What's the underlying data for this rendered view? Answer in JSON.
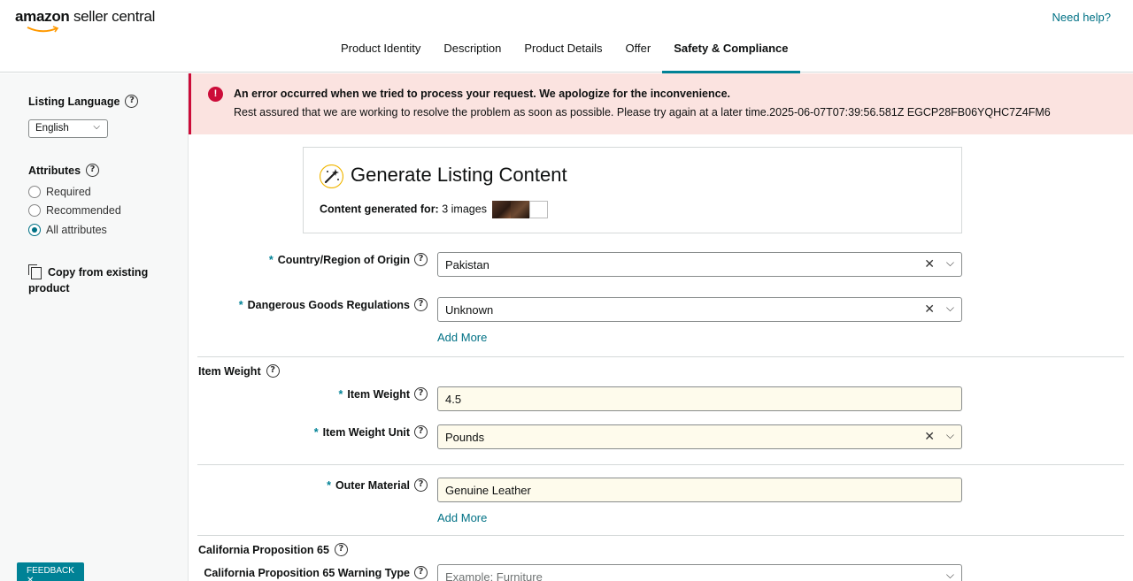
{
  "header": {
    "logo_brand": "amazon",
    "logo_product": "seller central",
    "help_link": "Need help?",
    "tabs": [
      {
        "label": "Product Identity",
        "active": false
      },
      {
        "label": "Description",
        "active": false
      },
      {
        "label": "Product Details",
        "active": false
      },
      {
        "label": "Offer",
        "active": false
      },
      {
        "label": "Safety & Compliance",
        "active": true
      }
    ]
  },
  "sidebar": {
    "listing_language_label": "Listing Language",
    "language_value": "English",
    "attributes_label": "Attributes",
    "attribute_options": [
      {
        "label": "Required",
        "checked": false
      },
      {
        "label": "Recommended",
        "checked": false
      },
      {
        "label": "All attributes",
        "checked": true
      }
    ],
    "copy_label": "Copy from existing product"
  },
  "error": {
    "title": "An error occurred when we tried to process your request. We apologize for the inconvenience.",
    "message": "Rest assured that we are working to resolve the problem as soon as possible. Please try again at a later time.2025-06-07T07:39:56.581Z EGCP28FB06YQHC7Z4FM6"
  },
  "generate": {
    "title": "Generate Listing Content",
    "sub_label": "Content generated for:",
    "sub_value": "3 images"
  },
  "form": {
    "country_label": "Country/Region of Origin",
    "country_value": "Pakistan",
    "dangerous_label": "Dangerous Goods Regulations",
    "dangerous_value": "Unknown",
    "add_more": "Add More",
    "item_weight_section": "Item Weight",
    "item_weight_label": "Item Weight",
    "item_weight_value": "4.5",
    "item_weight_unit_label": "Item Weight Unit",
    "item_weight_unit_value": "Pounds",
    "outer_material_label": "Outer Material",
    "outer_material_value": "Genuine Leather",
    "prop65_section": "California Proposition 65",
    "prop65_warning_label": "California Proposition 65 Warning Type",
    "prop65_warning_placeholder": "Example: Furniture"
  },
  "feedback": "FEEDBACK",
  "colors": {
    "accent": "#008296",
    "link": "#007185",
    "error": "#cc0c39",
    "error_bg": "#fbe3e0"
  }
}
